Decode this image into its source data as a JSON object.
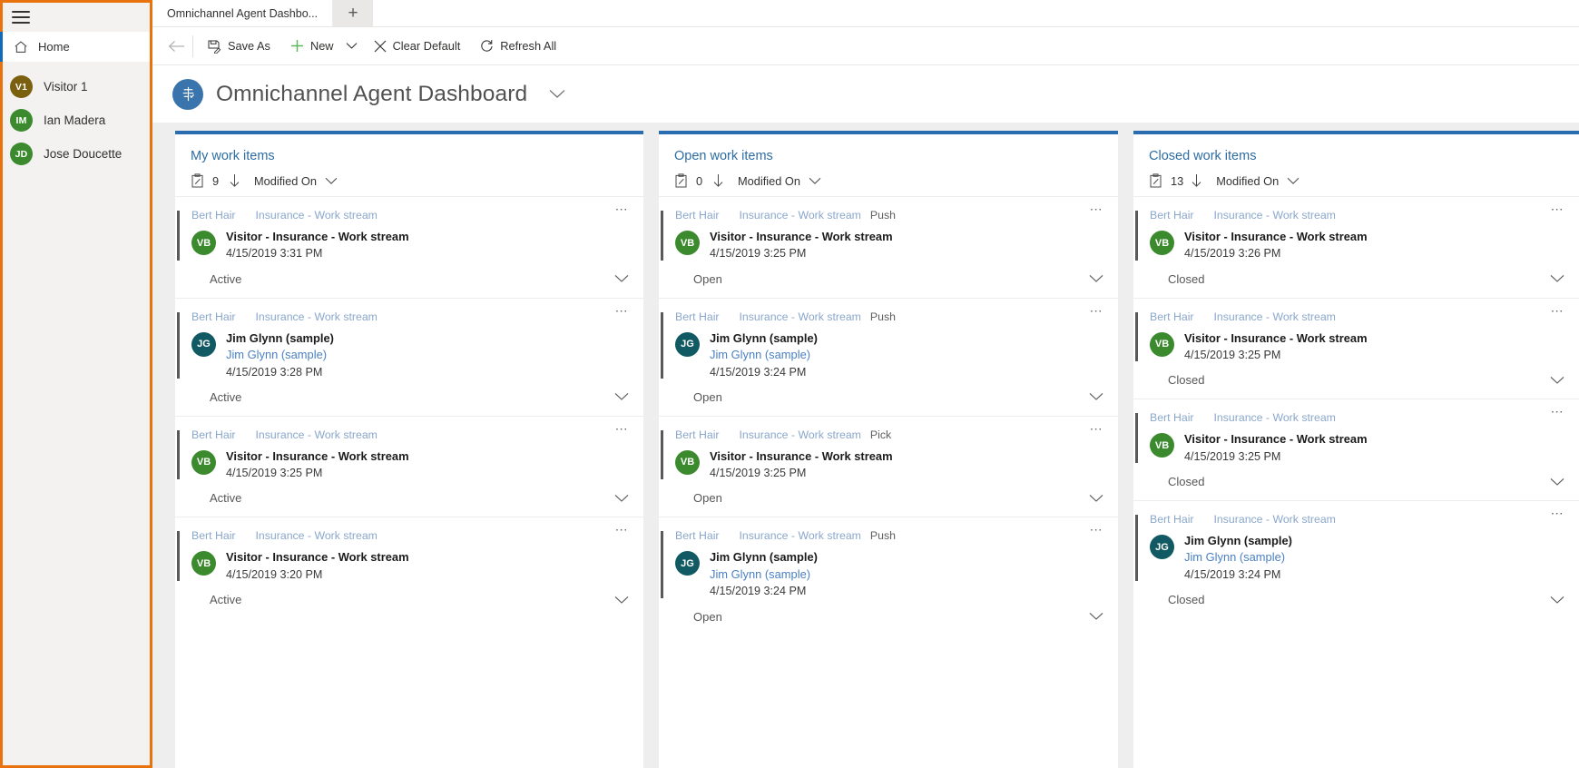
{
  "sidebar": {
    "menu_icon": "hamburger-icon",
    "home": {
      "label": "Home",
      "icon": "home-icon"
    },
    "people": [
      {
        "initials": "V1",
        "name": "Visitor 1",
        "color": "#7b6010"
      },
      {
        "initials": "IM",
        "name": "Ian Madera",
        "color": "#3b8a2e"
      },
      {
        "initials": "JD",
        "name": "Jose Doucette",
        "color": "#3b8a2e"
      }
    ]
  },
  "tabs": {
    "items": [
      {
        "label": "Omnichannel Agent Dashbo..."
      }
    ],
    "new_tab_label": "+"
  },
  "commandbar": {
    "back_label": "←",
    "save_as": "Save As",
    "new": "New",
    "clear_default": "Clear Default",
    "refresh_all": "Refresh All"
  },
  "dashboard": {
    "title": "Omnichannel Agent Dashboard",
    "icon": "dashboard-icon",
    "accent": "#2a6cb0"
  },
  "columns": [
    {
      "title": "My work items",
      "count": "9",
      "sort": "Modified On",
      "cards": [
        {
          "agent": "Bert Hair",
          "stream": "Insurance - Work stream",
          "mode": "",
          "initials": "VB",
          "avatar_color": "#3b8a2e",
          "title": "Visitor - Insurance - Work stream",
          "subtitle": "",
          "timestamp": "4/15/2019 3:31 PM",
          "status": "Active"
        },
        {
          "agent": "Bert Hair",
          "stream": "Insurance - Work stream",
          "mode": "",
          "initials": "JG",
          "avatar_color": "#115a63",
          "title": "Jim Glynn (sample)",
          "subtitle": "Jim Glynn (sample)",
          "timestamp": "4/15/2019 3:28 PM",
          "status": "Active"
        },
        {
          "agent": "Bert Hair",
          "stream": "Insurance - Work stream",
          "mode": "",
          "initials": "VB",
          "avatar_color": "#3b8a2e",
          "title": "Visitor - Insurance - Work stream",
          "subtitle": "",
          "timestamp": "4/15/2019 3:25 PM",
          "status": "Active"
        },
        {
          "agent": "Bert Hair",
          "stream": "Insurance - Work stream",
          "mode": "",
          "initials": "VB",
          "avatar_color": "#3b8a2e",
          "title": "Visitor - Insurance - Work stream",
          "subtitle": "",
          "timestamp": "4/15/2019 3:20 PM",
          "status": "Active"
        }
      ]
    },
    {
      "title": "Open work items",
      "count": "0",
      "sort": "Modified On",
      "cards": [
        {
          "agent": "Bert Hair",
          "stream": "Insurance - Work stream",
          "mode": "Push",
          "initials": "VB",
          "avatar_color": "#3b8a2e",
          "title": "Visitor - Insurance - Work stream",
          "subtitle": "",
          "timestamp": "4/15/2019 3:25 PM",
          "status": "Open"
        },
        {
          "agent": "Bert Hair",
          "stream": "Insurance - Work stream",
          "mode": "Push",
          "initials": "JG",
          "avatar_color": "#115a63",
          "title": "Jim Glynn (sample)",
          "subtitle": "Jim Glynn (sample)",
          "timestamp": "4/15/2019 3:24 PM",
          "status": "Open"
        },
        {
          "agent": "Bert Hair",
          "stream": "Insurance - Work stream",
          "mode": "Pick",
          "initials": "VB",
          "avatar_color": "#3b8a2e",
          "title": "Visitor - Insurance - Work stream",
          "subtitle": "",
          "timestamp": "4/15/2019 3:25 PM",
          "status": "Open"
        },
        {
          "agent": "Bert Hair",
          "stream": "Insurance - Work stream",
          "mode": "Push",
          "initials": "JG",
          "avatar_color": "#115a63",
          "title": "Jim Glynn (sample)",
          "subtitle": "Jim Glynn (sample)",
          "timestamp": "4/15/2019 3:24 PM",
          "status": "Open"
        }
      ]
    },
    {
      "title": "Closed work items",
      "count": "13",
      "sort": "Modified On",
      "cards": [
        {
          "agent": "Bert Hair",
          "stream": "Insurance - Work stream",
          "mode": "",
          "initials": "VB",
          "avatar_color": "#3b8a2e",
          "title": "Visitor - Insurance - Work stream",
          "subtitle": "",
          "timestamp": "4/15/2019 3:26 PM",
          "status": "Closed"
        },
        {
          "agent": "Bert Hair",
          "stream": "Insurance - Work stream",
          "mode": "",
          "initials": "VB",
          "avatar_color": "#3b8a2e",
          "title": "Visitor - Insurance - Work stream",
          "subtitle": "",
          "timestamp": "4/15/2019 3:25 PM",
          "status": "Closed"
        },
        {
          "agent": "Bert Hair",
          "stream": "Insurance - Work stream",
          "mode": "",
          "initials": "VB",
          "avatar_color": "#3b8a2e",
          "title": "Visitor - Insurance - Work stream",
          "subtitle": "",
          "timestamp": "4/15/2019 3:25 PM",
          "status": "Closed"
        },
        {
          "agent": "Bert Hair",
          "stream": "Insurance - Work stream",
          "mode": "",
          "initials": "JG",
          "avatar_color": "#115a63",
          "title": "Jim Glynn (sample)",
          "subtitle": "Jim Glynn (sample)",
          "timestamp": "4/15/2019 3:24 PM",
          "status": "Closed"
        }
      ]
    }
  ]
}
